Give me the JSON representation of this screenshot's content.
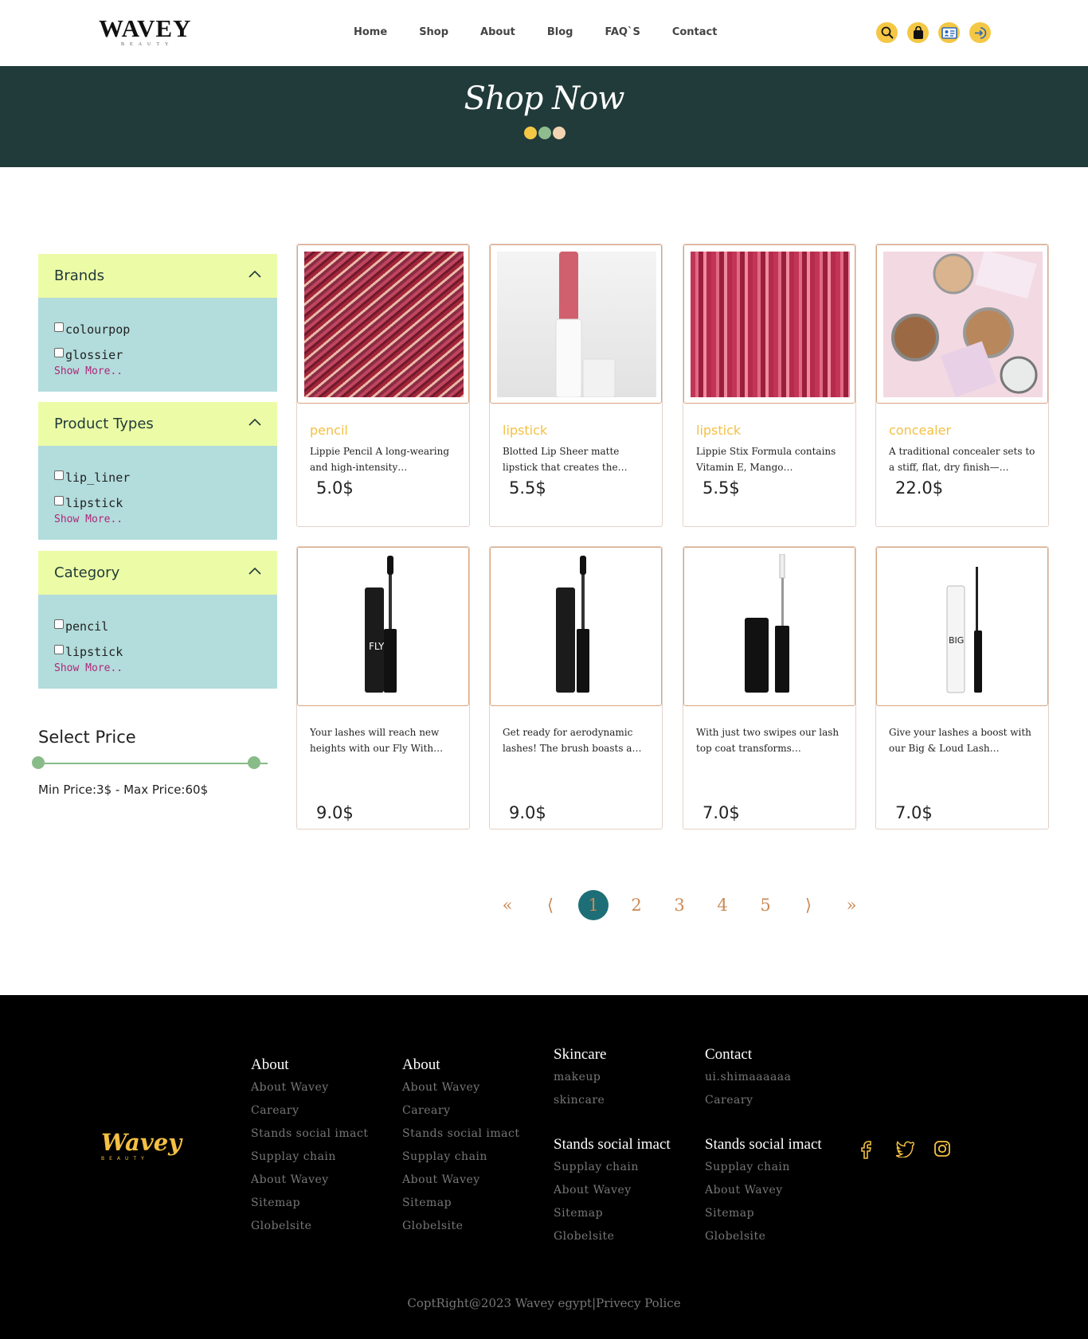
{
  "header": {
    "logo": "WAVEY",
    "logo_sub": "BEAUTY",
    "nav": [
      "Home",
      "Shop",
      "About",
      "Blog",
      "FAQ`S",
      "Contact"
    ],
    "icons": [
      "search-icon",
      "shopping-bag-icon",
      "profile-card-icon",
      "login-icon"
    ],
    "accent_color": "#f4c745"
  },
  "hero": {
    "title": "Shop Now",
    "bg_color": "#213b3a",
    "dot_colors": [
      "#f4c745",
      "#8fbc8f",
      "#f2d4b3"
    ]
  },
  "filters": [
    {
      "title": "Brands",
      "options": [
        "colourpop",
        "glossier"
      ],
      "more": "Show More.."
    },
    {
      "title": "Product Types",
      "options": [
        "lip_liner",
        "lipstick"
      ],
      "more": "Show More.."
    },
    {
      "title": "Category",
      "options": [
        "pencil",
        "lipstick"
      ],
      "more": "Show More.."
    }
  ],
  "price_filter": {
    "title": "Select Price",
    "range_text": "Min Price:3$ - Max Price:60$",
    "min": 3,
    "max": 60
  },
  "products": [
    {
      "category": "pencil",
      "desc": "Lippie Pencil A long-wearing and high-intensity…",
      "price": "5.0$"
    },
    {
      "category": "lipstick",
      "desc": "Blotted Lip Sheer matte lipstick that creates the…",
      "price": "5.5$"
    },
    {
      "category": "lipstick",
      "desc": "Lippie Stix Formula contains Vitamin E, Mango…",
      "price": "5.5$"
    },
    {
      "category": "concealer",
      "desc": "A traditional concealer sets to a stiff, flat, dry finish—…",
      "price": "22.0$"
    },
    {
      "category": "",
      "desc": "Your lashes will reach new heights with our Fly With…",
      "price": "9.0$"
    },
    {
      "category": "",
      "desc": "Get ready for aerodynamic lashes! The brush boasts a…",
      "price": "9.0$"
    },
    {
      "category": "",
      "desc": "With just two swipes our lash top coat transforms…",
      "price": "7.0$"
    },
    {
      "category": "",
      "desc": "Give your lashes a boost with our Big & Loud Lash…",
      "price": "7.0$"
    }
  ],
  "pagination": {
    "first": "«",
    "prev": "⟨",
    "pages": [
      "1",
      "2",
      "3",
      "4",
      "5"
    ],
    "next": "⟩",
    "last": "»",
    "current": "1"
  },
  "footer": {
    "logo": "Wavey",
    "logo_sub": "BEAUTY",
    "col1": {
      "title": "About",
      "links": [
        "About Wavey",
        "Careary",
        "Stands social imact",
        "Supplay chain",
        "About Wavey",
        "Sitemap",
        "Globelsite"
      ]
    },
    "col2": {
      "title": "About",
      "links": [
        "About Wavey",
        "Careary",
        "Stands social imact",
        "Supplay chain",
        "About Wavey",
        "Sitemap",
        "Globelsite"
      ]
    },
    "col3": {
      "title": "Skincare",
      "links": [
        "makeup",
        "skincare"
      ],
      "title2": "Stands social imact",
      "links2": [
        "Supplay chain",
        "About Wavey",
        "Sitemap",
        "Globelsite"
      ]
    },
    "col4": {
      "title": "Contact",
      "links": [
        "ui.shimaaaaaa",
        "Careary"
      ],
      "title2": "Stands social imact",
      "links2": [
        "Supplay chain",
        "About Wavey",
        "Sitemap",
        "Globelsite"
      ]
    },
    "social": [
      "facebook-icon",
      "twitter-icon",
      "instagram-icon"
    ],
    "copyright": "CoptRight@2023 Wavey egypt|Privecy Police"
  }
}
